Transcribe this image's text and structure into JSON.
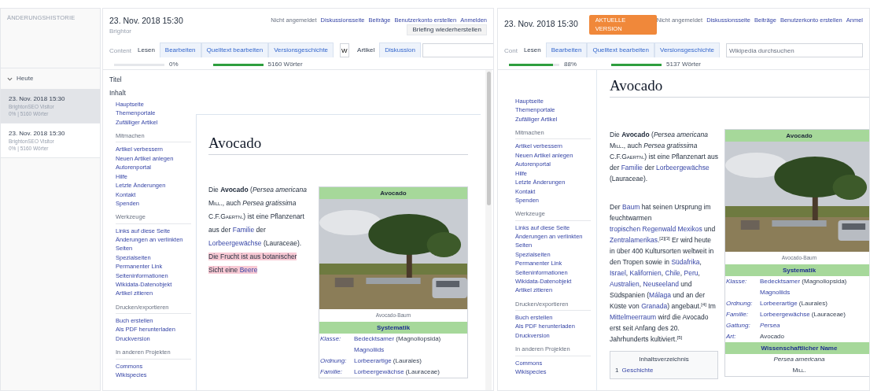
{
  "history": {
    "title": "ÄNDERUNGSHISTORIE",
    "group": {
      "label": "Heute",
      "expanded": true
    },
    "entries": [
      {
        "date": "23. Nov. 2018 15:30",
        "author": "BrightonSEO Visitor",
        "stats": "0% | 5160 Wörter",
        "selected": true
      },
      {
        "date": "23. Nov. 2018 15:30",
        "author": "BrightonSEO Visitor",
        "stats": "0% | 5160 Wörter",
        "selected": false
      }
    ]
  },
  "panels": [
    {
      "kind": "preview",
      "date": "23. Nov. 2018 15:30",
      "author": "Brightor",
      "content_label": "Content",
      "user_links": [
        "Nicht angemeldet",
        "Diskussionsseite",
        "Beiträge",
        "Benutzerkonto erstellen",
        "Anmelden"
      ],
      "restore_button": "Briefing wiederherstellen",
      "tabs": [
        {
          "label": "Lesen",
          "selected": true
        },
        {
          "label": "Bearbeiten",
          "selected": false
        },
        {
          "label": "Quelltext bearbeiten",
          "selected": false
        },
        {
          "label": "Versionsgeschichte",
          "selected": false
        }
      ],
      "search": {
        "value": "W"
      },
      "view_tabs": [
        {
          "label": "Artikel",
          "selected": true
        },
        {
          "label": "Diskussion",
          "selected": false
        }
      ],
      "completion": {
        "level": 0,
        "reading": "0%"
      },
      "word_count": {
        "level": 1,
        "reading": "5160 Wörter"
      },
      "scrollbar": true,
      "nav": {
        "headings": [
          "Titel",
          "Inhalt"
        ],
        "sections": [
          {
            "links": [
              "Hauptseite",
              "Themenportale",
              "Zufälliger Artikel"
            ]
          },
          {
            "heading": "Mitmachen",
            "links": [
              "Artikel verbessern",
              "Neuen Artikel anlegen",
              "Autorenportal",
              "Hilfe",
              "Letzte Änderungen",
              "Kontakt",
              "Spenden"
            ]
          },
          {
            "heading": "Werkzeuge",
            "links": [
              "Links auf diese Seite",
              "Änderungen an verlinkten Seiten",
              "Spezialseiten",
              "Permanenter Link",
              "Seiteninformationen",
              "Wikidata-Datenobjekt",
              "Artikel zitieren"
            ]
          },
          {
            "heading": "Drucken/exportieren",
            "links": [
              "Buch erstellen",
              "Als PDF herunterladen",
              "Druckversion"
            ]
          },
          {
            "heading": "In anderen Projekten",
            "links": [
              "Commons",
              "Wikispecies"
            ]
          }
        ]
      },
      "article": {
        "title": "Avocado",
        "paragraphs": [
          [
            {
              "kind": "plain",
              "text": "Die "
            },
            {
              "kind": "bold",
              "text": "Avocado"
            },
            {
              "kind": "plain",
              "text": " ("
            },
            {
              "kind": "italic",
              "text": "Persea americana "
            },
            {
              "kind": "smallcaps",
              "text": "Mill."
            },
            {
              "kind": "plain",
              "text": ", auch "
            },
            {
              "kind": "italic",
              "text": "Persea gratissima"
            },
            {
              "kind": "plain",
              "text": " C.F."
            },
            {
              "kind": "smallcaps",
              "text": "Gaertn."
            },
            {
              "kind": "plain",
              "text": ") ist eine Pflanzenart aus der "
            },
            {
              "kind": "link",
              "text": "Familie"
            },
            {
              "kind": "plain",
              "text": " der "
            },
            {
              "kind": "link",
              "text": "Lorbeergewächse"
            },
            {
              "kind": "plain",
              "text": " (Lauraceae). "
            },
            {
              "kind": "mark",
              "text": "Die Frucht ist aus botanischer Sicht eine "
            },
            {
              "kind": "mark_link",
              "text": "Beere"
            }
          ]
        ],
        "infobox": {
          "title": "Avocado",
          "caption": "Avocado-Baum",
          "sections": [
            {
              "heading": "Systematik",
              "rows": [
                {
                  "label": "Klasse:",
                  "value": [
                    {
                      "kind": "link",
                      "text": "Bedecktsamer"
                    },
                    {
                      "kind": "plain",
                      "text": " (Magnoliopsida)"
                    }
                  ]
                },
                {
                  "value": [
                    {
                      "kind": "link",
                      "text": "Magnoliids"
                    }
                  ]
                },
                {
                  "label": "Ordnung:",
                  "value": [
                    {
                      "kind": "link",
                      "text": "Lorbeerartige"
                    },
                    {
                      "kind": "plain",
                      "text": " (Laurales)"
                    }
                  ]
                },
                {
                  "label": "Familie:",
                  "value": [
                    {
                      "kind": "link",
                      "text": "Lorbeergewächse"
                    },
                    {
                      "kind": "plain",
                      "text": " (Lauraceae)"
                    }
                  ]
                }
              ]
            }
          ]
        }
      }
    },
    {
      "kind": "live",
      "date": "23. Nov. 2018 15:30",
      "badge": "AKTUELLE VERSION",
      "content_label": "Cont",
      "user_links": [
        "Nicht angemeldet",
        "Diskussionsseite",
        "Beiträge",
        "Benutzerkonto erstellen",
        "Anmel"
      ],
      "tabs": [
        {
          "label": "Lesen",
          "selected": true
        },
        {
          "label": "Bearbeiten",
          "selected": false
        },
        {
          "label": "Quelltext bearbeiten",
          "selected": false
        },
        {
          "label": "Versionsgeschichte",
          "selected": false
        }
      ],
      "search": {
        "placeholder": "Wikipedia durchsuchen"
      },
      "completion": {
        "level": 0.88,
        "reading": "88%"
      },
      "word_count": {
        "level": 1,
        "reading": "5137 Wörter"
      },
      "nav": {
        "sections": [
          {
            "links": [
              "Hauptseite",
              "Themenportale",
              "Zufälliger Artikel"
            ]
          },
          {
            "heading": "Mitmachen",
            "links": [
              "Artikel verbessern",
              "Neuen Artikel anlegen",
              "Autorenportal",
              "Hilfe",
              "Letzte Änderungen",
              "Kontakt",
              "Spenden"
            ]
          },
          {
            "heading": "Werkzeuge",
            "links": [
              "Links auf diese Seite",
              "Änderungen an verlinkten Seiten",
              "Spezialseiten",
              "Permanenter Link",
              "Seiteninformationen",
              "Wikidata-Datenobjekt",
              "Artikel zitieren"
            ]
          },
          {
            "heading": "Drucken/exportieren",
            "links": [
              "Buch erstellen",
              "Als PDF herunterladen",
              "Druckversion"
            ]
          },
          {
            "heading": "In anderen Projekten",
            "links": [
              "Commons",
              "Wikispecies"
            ]
          }
        ]
      },
      "article": {
        "title": "Avocado",
        "paragraphs": [
          [
            {
              "kind": "plain",
              "text": "Die "
            },
            {
              "kind": "bold",
              "text": "Avocado"
            },
            {
              "kind": "plain",
              "text": " ("
            },
            {
              "kind": "italic",
              "text": "Persea americana "
            },
            {
              "kind": "smallcaps",
              "text": "Mill."
            },
            {
              "kind": "plain",
              "text": ", auch "
            },
            {
              "kind": "italic",
              "text": "Persea gratissima"
            },
            {
              "kind": "plain",
              "text": " C.F."
            },
            {
              "kind": "smallcaps",
              "text": "Gaertn."
            },
            {
              "kind": "plain",
              "text": ") ist eine Pflanzenart aus der "
            },
            {
              "kind": "link",
              "text": "Familie"
            },
            {
              "kind": "plain",
              "text": " der "
            },
            {
              "kind": "link",
              "text": "Lorbeergewächse"
            },
            {
              "kind": "plain",
              "text": " (Lauraceae)."
            }
          ],
          [
            {
              "kind": "plain",
              "text": "Der "
            },
            {
              "kind": "link",
              "text": "Baum"
            },
            {
              "kind": "plain",
              "text": " hat seinen Ursprung im feuchtwarmen "
            },
            {
              "kind": "link",
              "text": "tropischen Regenwald Mexikos"
            },
            {
              "kind": "plain",
              "text": " und "
            },
            {
              "kind": "link",
              "text": "Zentralamerikas"
            },
            {
              "kind": "plain",
              "text": "."
            },
            {
              "kind": "sup",
              "text": "[2][3]"
            },
            {
              "kind": "plain",
              "text": " Er wird heute in über 400 Kultursorten weltweit in den Tropen sowie in "
            },
            {
              "kind": "link",
              "text": "Südafrika"
            },
            {
              "kind": "plain",
              "text": ", "
            },
            {
              "kind": "link",
              "text": "Israel"
            },
            {
              "kind": "plain",
              "text": ", "
            },
            {
              "kind": "link",
              "text": "Kalifornien"
            },
            {
              "kind": "plain",
              "text": ", "
            },
            {
              "kind": "link",
              "text": "Chile"
            },
            {
              "kind": "plain",
              "text": ", "
            },
            {
              "kind": "link",
              "text": "Peru"
            },
            {
              "kind": "plain",
              "text": ", "
            },
            {
              "kind": "link",
              "text": "Australien"
            },
            {
              "kind": "plain",
              "text": ", "
            },
            {
              "kind": "link",
              "text": "Neuseeland"
            },
            {
              "kind": "plain",
              "text": " und Südspanien ("
            },
            {
              "kind": "link",
              "text": "Málaga"
            },
            {
              "kind": "plain",
              "text": " und an der Küste von "
            },
            {
              "kind": "link",
              "text": "Granada"
            },
            {
              "kind": "plain",
              "text": ") angebaut."
            },
            {
              "kind": "sup",
              "text": "[4]"
            },
            {
              "kind": "plain",
              "text": " Im "
            },
            {
              "kind": "link",
              "text": "Mittelmeerraum"
            },
            {
              "kind": "plain",
              "text": " wird die Avocado erst seit Anfang des 20. Jahrhunderts kultiviert."
            },
            {
              "kind": "sup",
              "text": "[5]"
            }
          ]
        ],
        "toc": {
          "title": "Inhaltsverzeichnis",
          "items": [
            {
              "number": "1",
              "label": "Geschichte"
            }
          ]
        },
        "infobox": {
          "title": "Avocado",
          "caption": "Avocado-Baum",
          "sections": [
            {
              "heading": "Systematik",
              "rows": [
                {
                  "label": "Klasse:",
                  "value": [
                    {
                      "kind": "link",
                      "text": "Bedecktsamer"
                    },
                    {
                      "kind": "plain",
                      "text": " (Magnoliopsida)"
                    }
                  ]
                },
                {
                  "value": [
                    {
                      "kind": "link",
                      "text": "Magnoliids"
                    }
                  ]
                },
                {
                  "label": "Ordnung:",
                  "value": [
                    {
                      "kind": "link",
                      "text": "Lorbeerartige"
                    },
                    {
                      "kind": "plain",
                      "text": " (Laurales)"
                    }
                  ]
                },
                {
                  "label": "Familie:",
                  "value": [
                    {
                      "kind": "link",
                      "text": "Lorbeergewächse"
                    },
                    {
                      "kind": "plain",
                      "text": " (Lauraceae)"
                    }
                  ]
                },
                {
                  "label": "Gattung:",
                  "value": [
                    {
                      "kind": "link_italic",
                      "text": "Persea"
                    }
                  ]
                },
                {
                  "label": "Art:",
                  "value": [
                    {
                      "kind": "plain",
                      "text": "Avocado"
                    }
                  ]
                }
              ]
            },
            {
              "heading": "Wissenschaftlicher Name",
              "lines": [
                [
                  {
                    "kind": "italic",
                    "text": "Persea americana"
                  }
                ],
                [
                  {
                    "kind": "smallcaps",
                    "text": "Mill."
                  }
                ]
              ]
            }
          ]
        }
      }
    }
  ]
}
